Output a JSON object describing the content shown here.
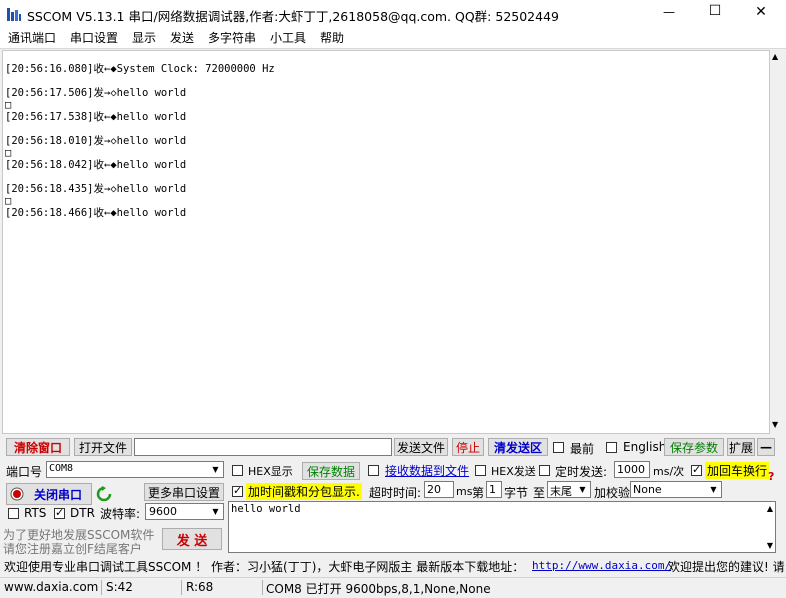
{
  "window": {
    "title": "SSCOM V5.13.1 串口/网络数据调试器,作者:大虾丁丁,2618058@qq.com. QQ群: 52502449",
    "minimize": "—",
    "maximize": "☐",
    "close": "✕"
  },
  "menu": [
    "通讯端口",
    "串口设置",
    "显示",
    "发送",
    "多字符串",
    "小工具",
    "帮助"
  ],
  "log": [
    {
      "ts": "[20:56:16.080]",
      "dir": "收←◆",
      "text": "System Clock: 72000000 Hz",
      "trail": ""
    },
    {
      "ts": "[20:56:17.506]",
      "dir": "发→◇",
      "text": "hello world",
      "trail": "□"
    },
    {
      "ts": "[20:56:17.538]",
      "dir": "收←◆",
      "text": "hello world",
      "trail": ""
    },
    {
      "ts": "[20:56:18.010]",
      "dir": "发→◇",
      "text": "hello world",
      "trail": "□"
    },
    {
      "ts": "[20:56:18.042]",
      "dir": "收←◆",
      "text": "hello world",
      "trail": ""
    },
    {
      "ts": "[20:56:18.435]",
      "dir": "发→◇",
      "text": "hello world",
      "trail": "□"
    },
    {
      "ts": "[20:56:18.466]",
      "dir": "收←◆",
      "text": "hello world",
      "trail": ""
    }
  ],
  "toolbar": {
    "clear": "清除窗口",
    "open_file": "打开文件",
    "send_file": "发送文件",
    "stop": "停止",
    "clear_send": "清发送区",
    "topmost": "最前",
    "english": "English",
    "save_params": "保存参数",
    "expand": "扩展",
    "collapse": "—"
  },
  "port": {
    "label": "端口号",
    "value": "COM8",
    "close_button": "关闭串口",
    "more_settings": "更多串口设置",
    "rts": "RTS",
    "dtr": "DTR",
    "baud_label": "波特率:",
    "baud": "9600"
  },
  "options": {
    "hex_display": "HEX显示",
    "save_data": "保存数据",
    "recv_to_file": "接收数据到文件",
    "hex_send": "HEX发送",
    "timed_send": "定时发送:",
    "interval": "1000",
    "interval_unit": "ms/次",
    "add_crlf": "加回车换行",
    "timestamp": "加时间戳和分包显示.",
    "timeout_label": "超时时间:",
    "timeout": "20",
    "timeout_unit": "ms",
    "byte_prefix": "第",
    "byte_index": "1",
    "byte_unit": "字节",
    "to": "至",
    "end": "末尾",
    "checksum_label": "加校验",
    "checksum": "None",
    "help": "?"
  },
  "send": {
    "text": "hello world",
    "button": "发 送"
  },
  "promo": {
    "line1": "为了更好地发展SSCOM软件",
    "line2": "请您注册嘉立创F结尾客户"
  },
  "ticker": {
    "text": "欢迎使用专业串口调试工具SSCOM ！  作者：习小猛(丁丁)，大虾电子网版主  最新版本下载地址：",
    "url": "http://www.daxia.com/",
    "tail": "欢迎提出您的建议! 请"
  },
  "status": {
    "site": "www.daxia.com",
    "sent": "S:42",
    "recv": "R:68",
    "port_status": "COM8 已打开  9600bps,8,1,None,None"
  },
  "colors": {
    "red": "#cc0000",
    "blue": "#0000cc",
    "green": "#008000",
    "highlight": "#ffff00"
  }
}
